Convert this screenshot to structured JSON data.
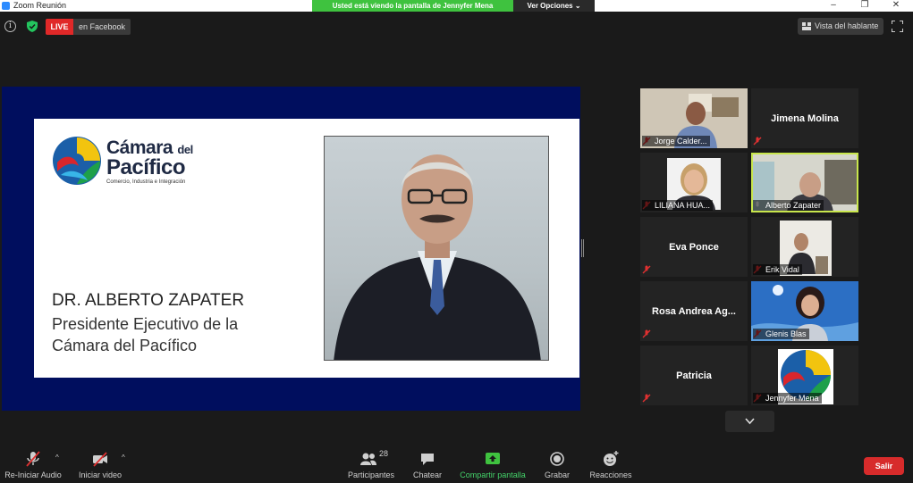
{
  "window": {
    "title": "Zoom Reunión",
    "minimize": "–",
    "restore": "❐",
    "close": "✕"
  },
  "share_banner": {
    "text": "Usted está viendo la pantalla de Jennyfer Mena",
    "options_label": "Ver Opciones ⌄"
  },
  "topbar": {
    "info_glyph": "i",
    "live_label": "LIVE",
    "live_platform": "en Facebook",
    "view_label": "Vista del hablante"
  },
  "slide": {
    "brand_line1": "Cámara",
    "brand_line1_small": "del",
    "brand_line2": "Pacífico",
    "brand_tagline": "Comercio, Industria e Integración",
    "name": "DR. ALBERTO ZAPATER",
    "role": "Presidente Ejecutivo de la Cámara del Pacífico"
  },
  "gallery": {
    "participants": [
      {
        "name": "Jorge Calder...",
        "video": true
      },
      {
        "name": "Jimena Molina",
        "video": false
      },
      {
        "name": "LILIANA HUA...",
        "video": true
      },
      {
        "name": "Alberto Zapater",
        "video": true,
        "active": true
      },
      {
        "name": "Eva Ponce",
        "video": false
      },
      {
        "name": "Erik Vidal",
        "video": true
      },
      {
        "name": "Rosa Andrea Ag...",
        "video": false
      },
      {
        "name": "Glenis Blas",
        "video": true
      },
      {
        "name": "Patricia",
        "video": false
      },
      {
        "name": "Jennyfer Mena",
        "video": true
      }
    ]
  },
  "toolbar": {
    "audio_label": "Re-Iniciar Audio",
    "video_label": "Iniciar video",
    "participants_label": "Participantes",
    "participants_count": "28",
    "chat_label": "Chatear",
    "share_label": "Compartir pantalla",
    "record_label": "Grabar",
    "reactions_label": "Reacciones",
    "leave_label": "Salir",
    "caret": "^"
  },
  "colors": {
    "share_green": "#3fc23f",
    "live_red": "#e02828",
    "leave_red": "#d72b2b",
    "active_speaker": "#c8e64c",
    "slide_navy": "#000e5e"
  }
}
